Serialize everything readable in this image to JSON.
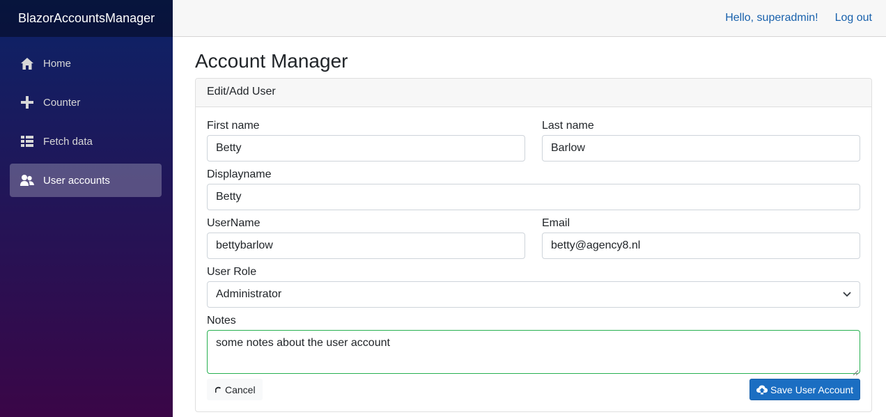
{
  "app": {
    "brand": "BlazorAccountsManager"
  },
  "sidebar": {
    "items": [
      {
        "label": "Home",
        "icon": "home-icon"
      },
      {
        "label": "Counter",
        "icon": "plus-icon"
      },
      {
        "label": "Fetch data",
        "icon": "list-icon"
      },
      {
        "label": "User accounts",
        "icon": "users-icon",
        "active": true
      }
    ]
  },
  "topbar": {
    "greeting": "Hello, superadmin!",
    "logout": "Log out"
  },
  "main": {
    "title": "Account Manager",
    "card_header": "Edit/Add User",
    "form": {
      "first_name": {
        "label": "First name",
        "value": "Betty"
      },
      "last_name": {
        "label": "Last name",
        "value": "Barlow"
      },
      "displayname": {
        "label": "Displayname",
        "value": "Betty"
      },
      "username": {
        "label": "UserName",
        "value": "bettybarlow"
      },
      "email": {
        "label": "Email",
        "value": "betty@agency8.nl"
      },
      "role": {
        "label": "User Role",
        "value": "Administrator"
      },
      "notes": {
        "label": "Notes",
        "value": "some notes about the user account"
      }
    },
    "buttons": {
      "cancel": "Cancel",
      "save": "Save User Account"
    }
  },
  "colors": {
    "accent": "#1b6ec2",
    "link": "#1861ac",
    "focus_border": "#26b050"
  }
}
